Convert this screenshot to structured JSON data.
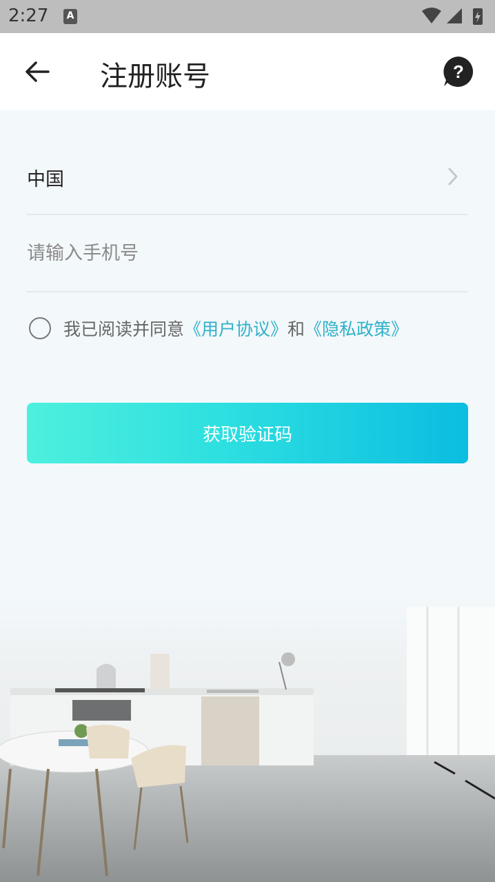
{
  "status_bar": {
    "time": "2:27",
    "notification_icon": "a-icon"
  },
  "app_bar": {
    "title": "注册账号",
    "back_icon": "arrow-left-icon",
    "help_icon": "help-bubble-icon"
  },
  "form": {
    "country": "中国",
    "phone_placeholder": "请输入手机号",
    "phone_value": "",
    "agreement": {
      "checked": false,
      "prefix": "我已阅读并同意",
      "user_agreement": "《用户协议》",
      "and": "和",
      "privacy_policy": "《隐私政策》"
    },
    "submit_label": "获取验证码"
  },
  "colors": {
    "accent_start": "#4ef0dd",
    "accent_end": "#0bbde0",
    "link": "#2fb1c8",
    "background": "#f3f8fb"
  }
}
